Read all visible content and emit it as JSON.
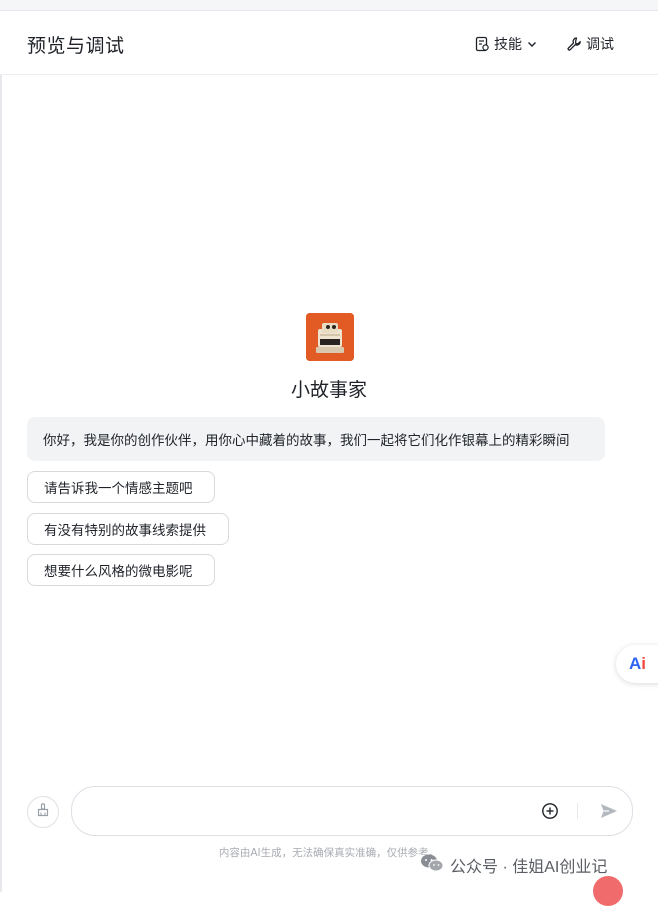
{
  "header": {
    "title": "预览与调试",
    "skills_label": "技能",
    "debug_label": "调试"
  },
  "bot": {
    "name": "小故事家",
    "avatar_icon": "robot-typewriter-avatar",
    "greeting": "你好，我是你的创作伙伴，用你心中藏着的故事，我们一起将它们化作银幕上的精彩瞬间"
  },
  "suggestions": [
    "请告诉我一个情感主题吧",
    "有没有特别的故事线索提供",
    "想要什么风格的微电影呢"
  ],
  "badge": {
    "a": "A",
    "i": "i"
  },
  "input": {
    "value": "",
    "placeholder": ""
  },
  "disclaimer": "内容由AI生成，无法确保真实准确，仅供参考。",
  "watermark": {
    "text": "公众号 · 佳姐AI创业记"
  },
  "colors": {
    "accent": "#e25a24",
    "badge_a": "#2f64f5",
    "badge_i": "#f04a3c"
  }
}
